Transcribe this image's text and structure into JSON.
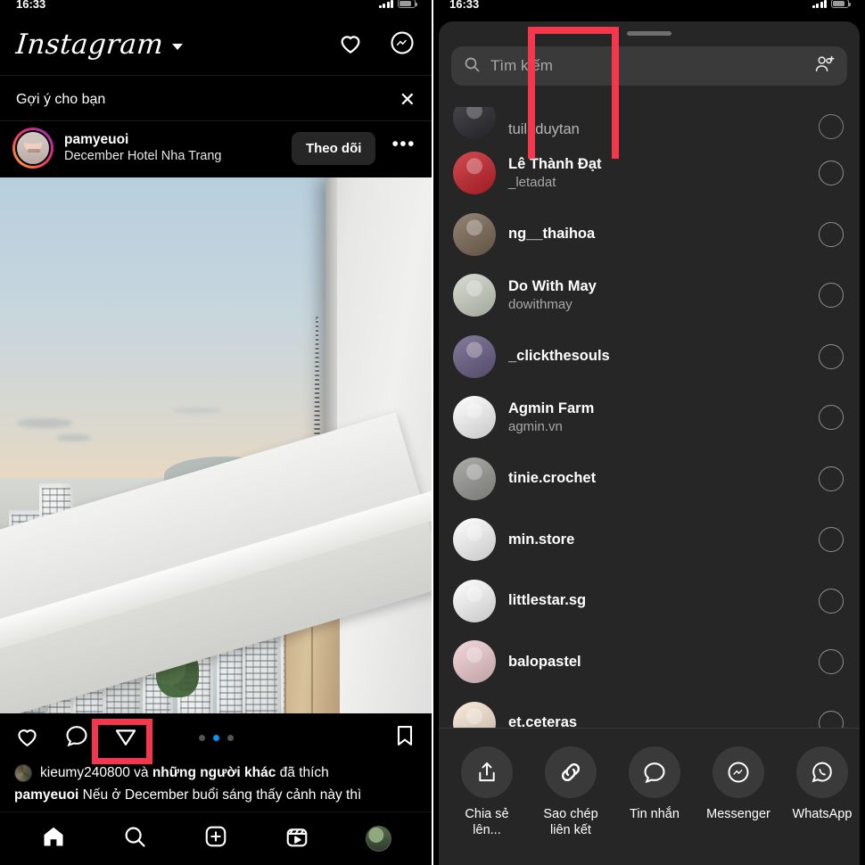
{
  "left_phone": {
    "status_bar": {
      "time": "16:33",
      "signal": "signal-bars",
      "battery": "battery-icon"
    },
    "header": {
      "logo": "Instagram",
      "chevron": "chevron-down-icon",
      "like_icon": "heart-icon",
      "messenger_icon": "messenger-icon"
    },
    "suggestion": {
      "title": "Gợi ý cho bạn",
      "close_label": "✕",
      "username": "pamyeuoi",
      "subtitle": "December Hotel Nha Trang",
      "follow_label": "Theo dõi",
      "more_label": "•••"
    },
    "post": {
      "carousel": {
        "total": 3,
        "active_index": 1
      },
      "actions": {
        "like": "heart-icon",
        "comment": "comment-icon",
        "share": "paper-plane-icon",
        "save": "bookmark-icon"
      },
      "likes_text_plain_1": "kieumy240800",
      "likes_text_mid": " và ",
      "likes_text_bold": "những người khác",
      "likes_text_end": " đã thích",
      "caption_user": "pamyeuoi",
      "caption_text": " Nếu ở December buổi sáng thấy cảnh này thì"
    },
    "tabbar": {
      "home": "home-icon",
      "search": "search-icon",
      "create": "plus-box-icon",
      "reels": "reels-icon",
      "profile": "profile-avatar"
    },
    "highlight": {
      "color": "#f4374c",
      "target": "share-button"
    }
  },
  "right_phone": {
    "status_bar": {
      "time": "16:33"
    },
    "sheet": {
      "grabber": "drag-handle",
      "search": {
        "icon": "search-icon",
        "placeholder": "Tìm kiếm",
        "add_people_icon": "add-people-icon"
      },
      "contacts": [
        {
          "name": "tuiladuytan",
          "handle": "",
          "partial": true,
          "avatar_color": "#2b2b33"
        },
        {
          "name": "Lê Thành Đạt",
          "handle": "_letadat",
          "partial": false,
          "avatar_color": "#c8232c"
        },
        {
          "name": "ng__thaihoa",
          "handle": "",
          "partial": false,
          "avatar_color": "#7c6a57"
        },
        {
          "name": "Do With May",
          "handle": "dowithmay",
          "partial": false,
          "avatar_color": "#cfd6c8"
        },
        {
          "name": "_clickthesouls",
          "handle": "",
          "partial": false,
          "avatar_color": "#6a5f86"
        },
        {
          "name": "Agmin Farm",
          "handle": "agmin.vn",
          "partial": false,
          "avatar_color": "#ffffff"
        },
        {
          "name": "tinie.crochet",
          "handle": "",
          "partial": false,
          "avatar_color": "#9a9a96"
        },
        {
          "name": "min.store",
          "handle": "",
          "partial": false,
          "avatar_color": "#ffffff"
        },
        {
          "name": "littlestar.sg",
          "handle": "",
          "partial": false,
          "avatar_color": "#ffffff"
        },
        {
          "name": "balopastel",
          "handle": "",
          "partial": false,
          "avatar_color": "#f2cfd4"
        },
        {
          "name": "et.ceteras_",
          "handle": "",
          "partial": false,
          "avatar_color": "#fbe7d6"
        }
      ],
      "share_options": [
        {
          "label": "Chia sẻ lên...",
          "icon": "share-up-icon"
        },
        {
          "label": "Sao chép liên kết",
          "icon": "link-icon"
        },
        {
          "label": "Tin nhắn",
          "icon": "message-bubble-icon"
        },
        {
          "label": "Messenger",
          "icon": "messenger-icon"
        },
        {
          "label": "WhatsApp",
          "icon": "whatsapp-icon"
        }
      ]
    },
    "highlight": {
      "color": "#f4374c",
      "target": "copy-link-button"
    }
  }
}
